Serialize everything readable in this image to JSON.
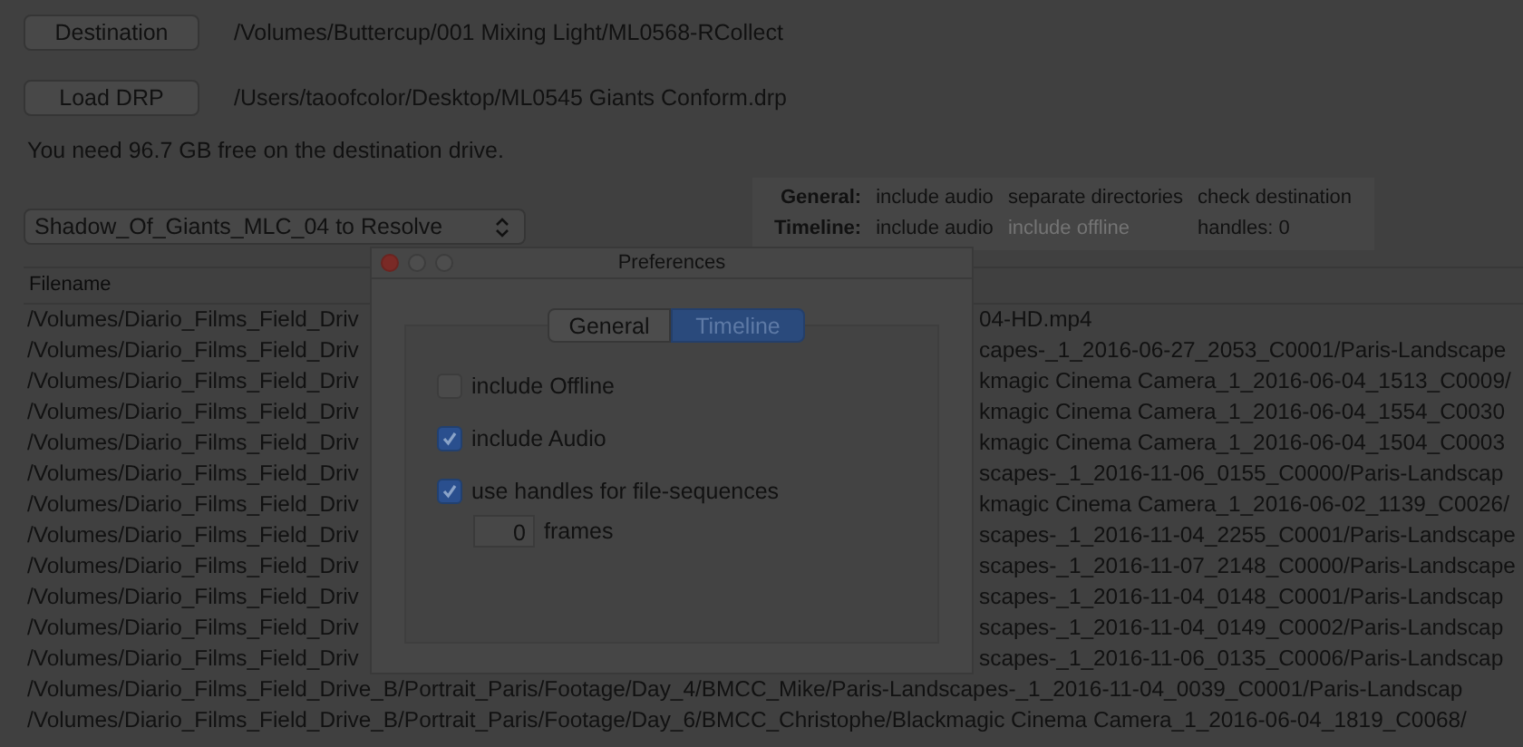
{
  "source_rows": [
    {
      "button": "Destination",
      "path": "/Volumes/Buttercup/001 Mixing Light/ML0568-RCollect"
    },
    {
      "button": "Load DRP",
      "path": "/Users/taoofcolor/Desktop/ML0545 Giants Conform.drp"
    }
  ],
  "space_notice": "You need 96.7 GB free on the destination drive.",
  "project_select": {
    "value": "Shadow_Of_Giants_MLC_04 to Resolve"
  },
  "summary": [
    {
      "label": "General:",
      "items": [
        {
          "text": "include audio",
          "disabled": false
        },
        {
          "text": "separate directories",
          "disabled": false
        },
        {
          "text": "check destination",
          "disabled": false
        }
      ]
    },
    {
      "label": "Timeline:",
      "items": [
        {
          "text": "include audio",
          "disabled": false
        },
        {
          "text": "include offline",
          "disabled": true
        },
        {
          "text": "handles:  0",
          "disabled": false
        }
      ]
    }
  ],
  "table": {
    "columns": [
      "Filename"
    ],
    "rows": [
      {
        "kind": "covered",
        "left": "/Volumes/Diario_Films_Field_Driv",
        "right": "04-HD.mp4"
      },
      {
        "kind": "covered",
        "left": "/Volumes/Diario_Films_Field_Driv",
        "right": "capes-_1_2016-06-27_2053_C0001/Paris-Landscape"
      },
      {
        "kind": "covered",
        "left": "/Volumes/Diario_Films_Field_Driv",
        "right": "kmagic Cinema Camera_1_2016-06-04_1513_C0009/"
      },
      {
        "kind": "covered",
        "left": "/Volumes/Diario_Films_Field_Driv",
        "right": "kmagic Cinema Camera_1_2016-06-04_1554_C0030"
      },
      {
        "kind": "covered",
        "left": "/Volumes/Diario_Films_Field_Driv",
        "right": "kmagic Cinema Camera_1_2016-06-04_1504_C0003"
      },
      {
        "kind": "covered",
        "left": "/Volumes/Diario_Films_Field_Driv",
        "right": "scapes-_1_2016-11-06_0155_C0000/Paris-Landscap"
      },
      {
        "kind": "covered",
        "left": "/Volumes/Diario_Films_Field_Driv",
        "right": "kmagic Cinema Camera_1_2016-06-02_1139_C0026/"
      },
      {
        "kind": "covered",
        "left": "/Volumes/Diario_Films_Field_Driv",
        "right": "scapes-_1_2016-11-04_2255_C0001/Paris-Landscape"
      },
      {
        "kind": "covered",
        "left": "/Volumes/Diario_Films_Field_Driv",
        "right": "scapes-_1_2016-11-07_2148_C0000/Paris-Landscape"
      },
      {
        "kind": "covered",
        "left": "/Volumes/Diario_Films_Field_Driv",
        "right": "scapes-_1_2016-11-04_0148_C0001/Paris-Landscap"
      },
      {
        "kind": "covered",
        "left": "/Volumes/Diario_Films_Field_Driv",
        "right": "scapes-_1_2016-11-04_0149_C0002/Paris-Landscap"
      },
      {
        "kind": "covered",
        "left": "/Volumes/Diario_Films_Field_Driv",
        "right": "scapes-_1_2016-11-06_0135_C0006/Paris-Landscap"
      },
      {
        "kind": "full",
        "text": "/Volumes/Diario_Films_Field_Drive_B/Portrait_Paris/Footage/Day_4/BMCC_Mike/Paris-Landscapes-_1_2016-11-04_0039_C0001/Paris-Landscap"
      },
      {
        "kind": "full",
        "text": "/Volumes/Diario_Films_Field_Drive_B/Portrait_Paris/Footage/Day_6/BMCC_Christophe/Blackmagic Cinema Camera_1_2016-06-04_1819_C0068/"
      }
    ]
  },
  "preferences": {
    "title": "Preferences",
    "tabs": [
      {
        "label": "General",
        "selected": false
      },
      {
        "label": "Timeline",
        "selected": true
      }
    ],
    "options": [
      {
        "label": "include Offline",
        "checked": false
      },
      {
        "label": "include Audio",
        "checked": true
      },
      {
        "label": "use handles for file-sequences",
        "checked": true
      }
    ],
    "handles": {
      "value": "0",
      "unit": "frames"
    }
  }
}
